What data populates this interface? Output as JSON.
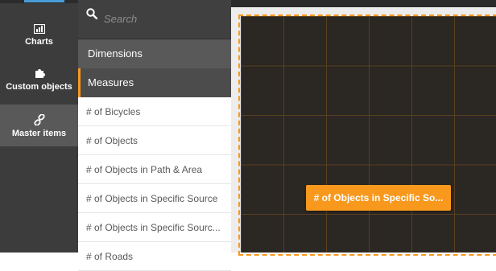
{
  "sidebar": {
    "items": [
      {
        "label": "Charts",
        "icon": "bar-chart-icon"
      },
      {
        "label": "Custom objects",
        "icon": "puzzle-icon"
      },
      {
        "label": "Master items",
        "icon": "link-icon",
        "active": true
      }
    ]
  },
  "panel": {
    "search_placeholder": "Search",
    "sections": [
      {
        "label": "Dimensions"
      },
      {
        "label": "Measures",
        "active": true
      }
    ],
    "items": [
      "# of Bicycles",
      "# of Objects",
      "# of Objects in Path & Area",
      "# of Objects in Specific Source",
      "# of Objects in Specific Sourc...",
      "# of Roads"
    ]
  },
  "canvas": {
    "drag_label": "# of Objects in Specific So..."
  },
  "colors": {
    "accent": "#f8981d",
    "rail": "#3c3c3c",
    "canvas": "#2b2722"
  }
}
